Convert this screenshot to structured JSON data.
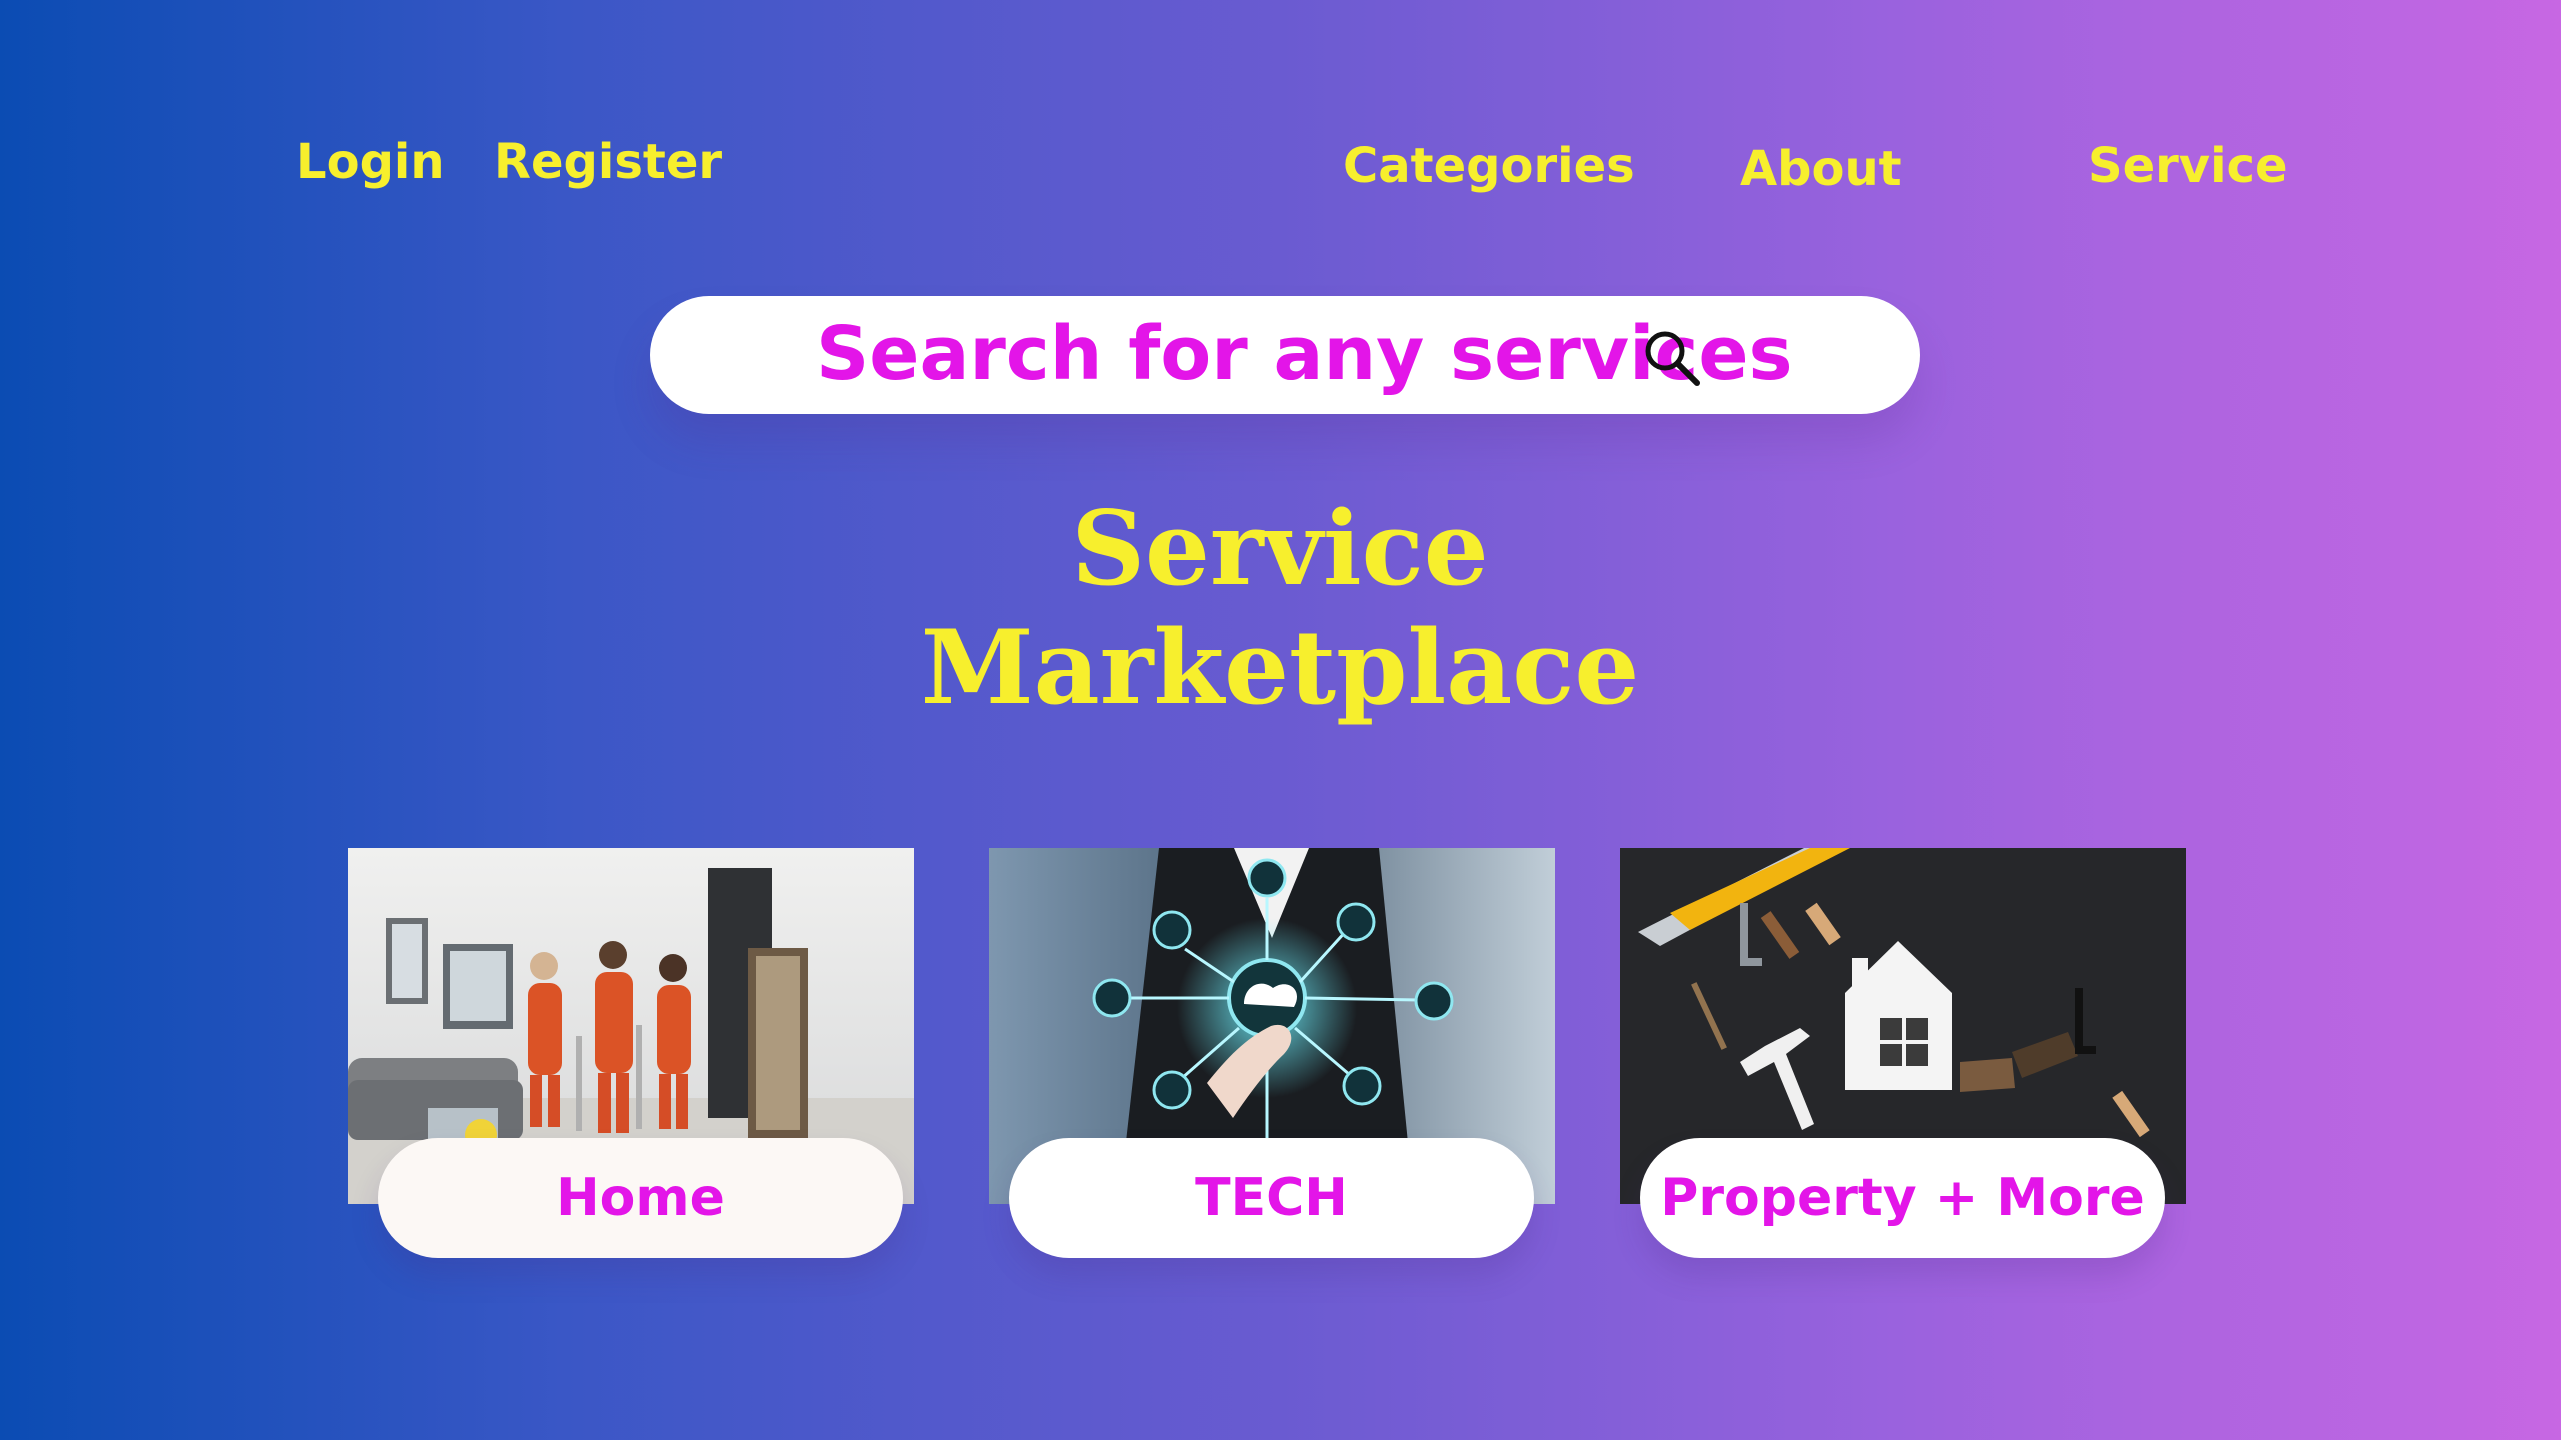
{
  "nav": {
    "login": "Login",
    "register": "Register",
    "categories": "Categories",
    "about": "About",
    "service": "Service"
  },
  "search": {
    "placeholder": "Search for any services",
    "icon": "search-icon"
  },
  "hero": {
    "line1": "Service",
    "line2": "Marketplace"
  },
  "cards": [
    {
      "label": "Home",
      "image": "cleaning-team-photo"
    },
    {
      "label": "TECH",
      "image": "tech-network-photo"
    },
    {
      "label": "Property + More",
      "image": "tools-house-photo"
    }
  ],
  "colors": {
    "gradient_start": "#0b4cb3",
    "gradient_end": "#c767e3",
    "accent_yellow": "#f7ef2d",
    "accent_magenta": "#e315e8",
    "card_white": "#ffffff"
  }
}
